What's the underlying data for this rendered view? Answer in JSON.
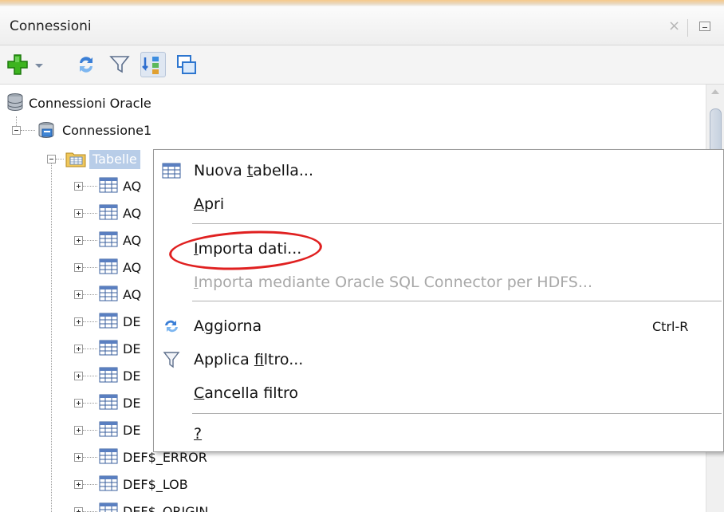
{
  "panel": {
    "title": "Connessioni"
  },
  "toolbar": {
    "buttons": [
      {
        "name": "add-connection",
        "icon": "green-plus-icon"
      },
      {
        "name": "dropdown",
        "icon": "chevron-down-icon"
      },
      {
        "name": "refresh",
        "icon": "refresh-icon"
      },
      {
        "name": "filter",
        "icon": "funnel-filter-icon"
      },
      {
        "name": "schema-browser",
        "icon": "schema-icon"
      },
      {
        "name": "connections-view",
        "icon": "windows-icon"
      }
    ]
  },
  "tree": {
    "root": "Connessioni Oracle",
    "connection": "Connessione1",
    "folder": "Tabelle",
    "tables": [
      "AQ",
      "AQ",
      "AQ",
      "AQ",
      "AQ",
      "DE",
      "DE",
      "DE",
      "DE",
      "DE",
      "DEF$_ERROR",
      "DEF$_LOB",
      "DEF$_ORIGIN"
    ]
  },
  "context_menu": {
    "items": [
      {
        "pre": "Nuova ",
        "u": "t",
        "post": "abella...",
        "icon": "table-icon"
      },
      {
        "pre": "",
        "u": "A",
        "post": "pri"
      },
      {
        "pre": "",
        "u": "I",
        "post": "mporta dati...",
        "highlighted": true
      },
      {
        "pre": "",
        "u": "I",
        "post": "mporta mediante Oracle SQL Connector per HDFS...",
        "disabled": true
      },
      {
        "pre": "A",
        "u": "g",
        "post": "giorna",
        "icon": "refresh-icon",
        "shortcut": "Ctrl-R"
      },
      {
        "pre": "Applica ",
        "u": "f",
        "post": "iltro...",
        "icon": "funnel-filter-icon"
      },
      {
        "pre": "",
        "u": "C",
        "post": "ancella filtro"
      },
      {
        "pre": "",
        "u": "?",
        "post": ""
      }
    ]
  },
  "annotation_color": "#e02020"
}
